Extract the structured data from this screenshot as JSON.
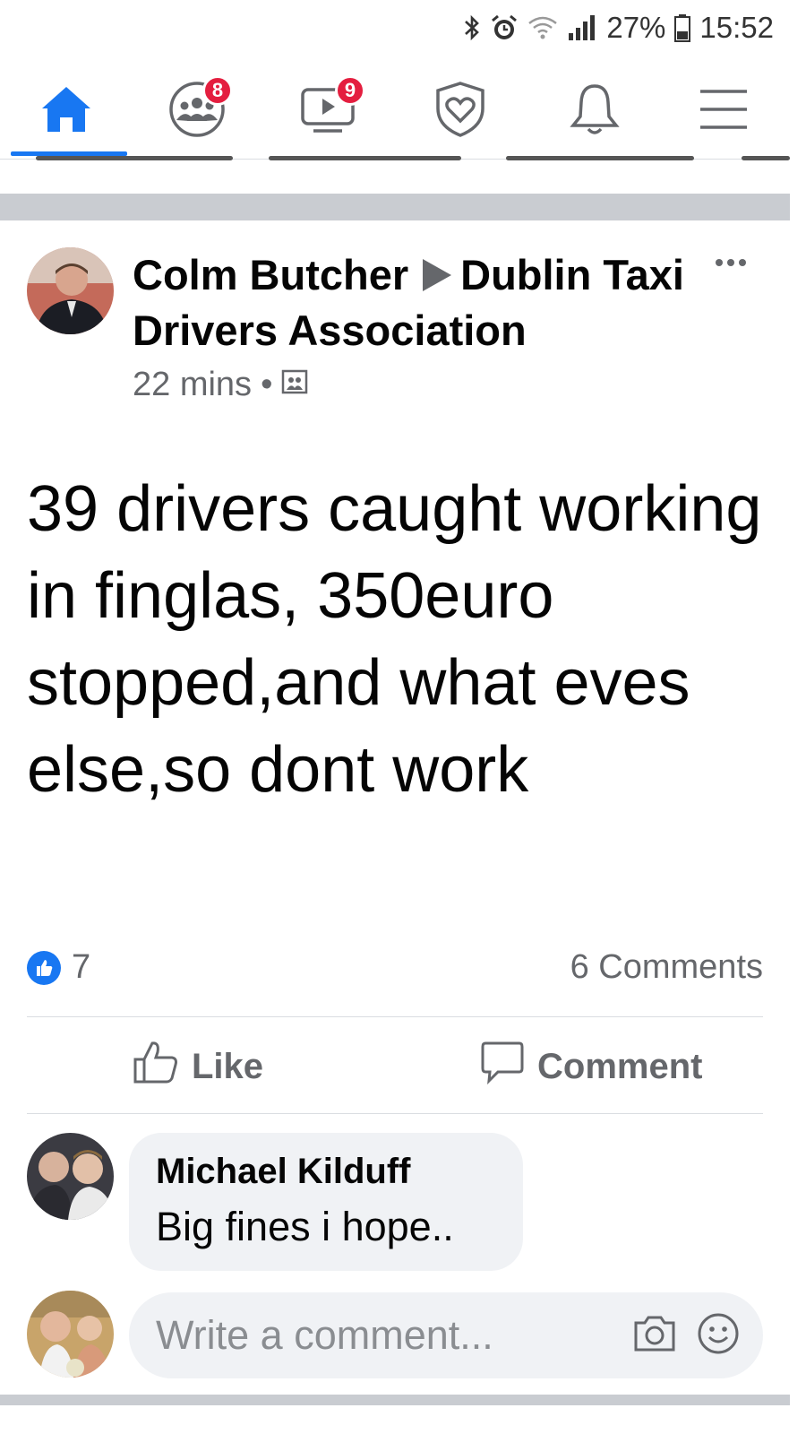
{
  "status_bar": {
    "battery": "27%",
    "time": "15:52",
    "icons": [
      "bluetooth-icon",
      "alarm-icon",
      "wifi-icon",
      "signal-icon",
      "battery-icon"
    ]
  },
  "nav": {
    "items": [
      {
        "name": "home",
        "icon": "home-icon",
        "active": true
      },
      {
        "name": "groups",
        "icon": "groups-icon",
        "badge": "8"
      },
      {
        "name": "watch",
        "icon": "video-icon",
        "badge": "9"
      },
      {
        "name": "dating",
        "icon": "shield-heart-icon"
      },
      {
        "name": "notifications",
        "icon": "bell-icon"
      },
      {
        "name": "menu",
        "icon": "hamburger-icon"
      }
    ]
  },
  "post": {
    "author": "Colm Butcher",
    "group": "Dublin Taxi Drivers Association",
    "time": "22 mins",
    "audience_icon": "group-audience-icon",
    "text": "39 drivers caught working in finglas, 350euro stopped,and what eves else,so dont work",
    "reaction_count": "7",
    "comments_label": "6 Comments",
    "like_label": "Like",
    "comment_label": "Comment"
  },
  "comment": {
    "author": "Michael Kilduff",
    "text": "Big fines i hope.."
  },
  "composer": {
    "placeholder": "Write a comment..."
  },
  "colors": {
    "accent": "#1877f2",
    "badge": "#e41e3f",
    "secondary_text": "#65676b",
    "separator": "#c9ccd1",
    "bubble": "#f0f2f5"
  }
}
